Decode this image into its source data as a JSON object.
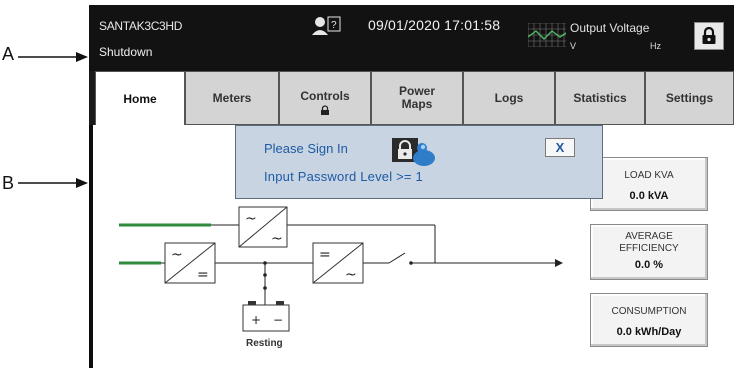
{
  "callouts": {
    "a": "A",
    "b": "B"
  },
  "header": {
    "model": "SANTAK3C3HD",
    "status": "Shutdown",
    "datetime": "09/01/2020 17:01:58",
    "output_label": "Output Voltage",
    "output_voltage_unit": "V",
    "output_freq_unit": "Hz",
    "user_badge": "?",
    "icons": [
      "user-help-icon",
      "waveform-graph-icon",
      "lock-icon"
    ]
  },
  "tabs": [
    {
      "label": "Home",
      "active": true
    },
    {
      "label": "Meters"
    },
    {
      "label": "Controls",
      "icon": "lock-icon"
    },
    {
      "label": "Power Maps"
    },
    {
      "label": "Logs"
    },
    {
      "label": "Statistics"
    },
    {
      "label": "Settings"
    }
  ],
  "popup": {
    "title": "Please Sign In",
    "message": "Input Password Level >= 1",
    "close_label": "X",
    "icons": [
      "user-lock-icon",
      "close-icon"
    ]
  },
  "diagram": {
    "battery_plus": "+",
    "battery_minus": "−",
    "battery_label": "Resting",
    "converter_symbols": {
      "ac": "~",
      "dc": "="
    }
  },
  "info_boxes": [
    {
      "label": "LOAD KVA",
      "value": "0.0 kVA"
    },
    {
      "label": "AVERAGE EFFICIENCY",
      "value": "0.0 %"
    },
    {
      "label": "CONSUMPTION",
      "value": "0.0 kWh/Day"
    }
  ],
  "colors": {
    "screen_bg": "#0c0c0c",
    "popup_bg": "#c8d4e1",
    "popup_text": "#1e5aa6",
    "line_green": "#2e8a3c"
  }
}
